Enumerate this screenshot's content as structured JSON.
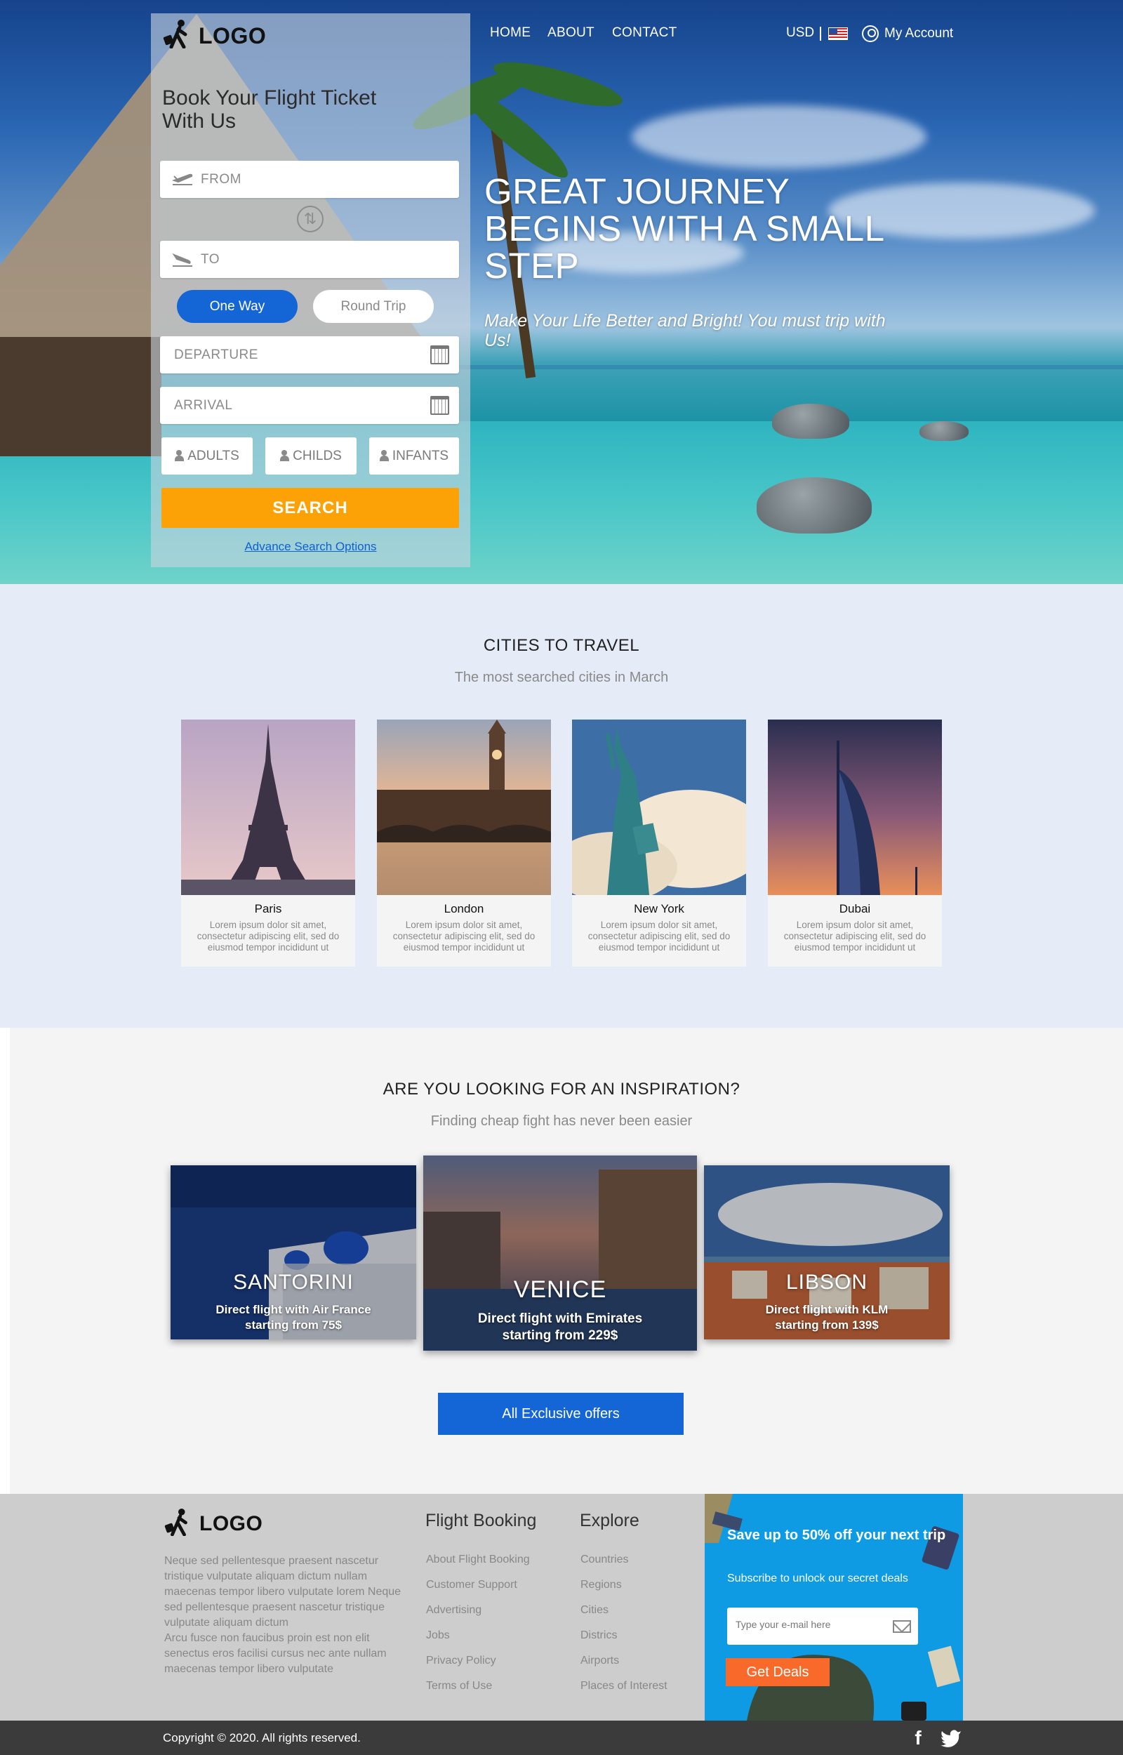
{
  "header": {
    "logo_text": "LOGO",
    "nav": [
      "HOME",
      "ABOUT",
      "CONTACT"
    ],
    "currency": "USD",
    "account_label": "My Account"
  },
  "booking": {
    "title": "Book Your Flight Ticket With Us",
    "from_label": "FROM",
    "to_label": "TO",
    "trip_types": [
      "One Way",
      "Round Trip"
    ],
    "selected_trip": "One Way",
    "departure_label": "DEPARTURE",
    "arrival_label": "ARRIVAL",
    "passengers": [
      "ADULTS",
      "CHILDS",
      "INFANTS"
    ],
    "search_label": "SEARCH",
    "advanced_link": "Advance Search Options"
  },
  "hero": {
    "headline": "GREAT JOURNEY BEGINS WITH A SMALL STEP",
    "subline": "Make Your Life Better and Bright!  You must trip with Us!"
  },
  "cities": {
    "title": "CITIES TO TRAVEL",
    "subtitle": "The most searched cities in March",
    "items": [
      {
        "name": "Paris",
        "desc": "Lorem ipsum dolor sit amet, consectetur adipiscing elit, sed do eiusmod tempor incididunt ut"
      },
      {
        "name": "London",
        "desc": "Lorem ipsum dolor sit amet, consectetur adipiscing elit, sed do eiusmod tempor incididunt ut"
      },
      {
        "name": "New York",
        "desc": "Lorem ipsum dolor sit amet, consectetur adipiscing elit, sed do eiusmod tempor incididunt ut"
      },
      {
        "name": "Dubai",
        "desc": "Lorem ipsum dolor sit amet, consectetur adipiscing elit, sed do eiusmod tempor incididunt ut"
      }
    ]
  },
  "inspiration": {
    "title": "ARE YOU LOOKING FOR AN INSPIRATION?",
    "subtitle": "Finding cheap fight has never been easier",
    "destinations": [
      {
        "name": "SANTORINI",
        "line1": "Direct flight with Air France",
        "line2_prefix": "starting from ",
        "price": "75$"
      },
      {
        "name": "VENICE",
        "line1": "Direct flight with Emirates",
        "line2_prefix": "starting from ",
        "price": "229$"
      },
      {
        "name": "LIBSON",
        "line1": "Direct flight with KLM",
        "line2_prefix": "starting from ",
        "price": "139$"
      }
    ],
    "button_label": "All Exclusive offers"
  },
  "footer": {
    "logo_text": "LOGO",
    "about_p1": "Neque sed pellentesque praesent nascetur tristique vulputate aliquam dictum nullam maecenas tempor libero vulputate lorem Neque sed pellentesque praesent nascetur tristique vulputate aliquam dictum",
    "about_p2": "Arcu fusce non faucibus proin est non elit senectus eros facilisi cursus nec ante nullam maecenas tempor libero vulputate",
    "flight_booking": {
      "heading": "Flight Booking",
      "links": [
        "About Flight Booking",
        "Customer Support",
        "Advertising",
        "Jobs",
        "Privacy Policy",
        "Terms of Use"
      ]
    },
    "explore": {
      "heading": "Explore",
      "links": [
        "Countries",
        "Regions",
        "Cities",
        "Districs",
        "Airports",
        "Places of Interest"
      ]
    },
    "promo": {
      "title": "Save up to 50% off your next trip",
      "subtitle": "Subscribe to unlock our secret deals",
      "email_placeholder": "Type your e-mail here",
      "button_label": "Get Deals"
    },
    "copyright": "Copyright © 2020. All rights reserved."
  },
  "colors": {
    "primary_blue": "#1466d6",
    "search_orange": "#fca206",
    "deals_orange": "#f96a2a",
    "promo_blue": "#0f9be3",
    "cities_bg": "#e6ecf7"
  }
}
